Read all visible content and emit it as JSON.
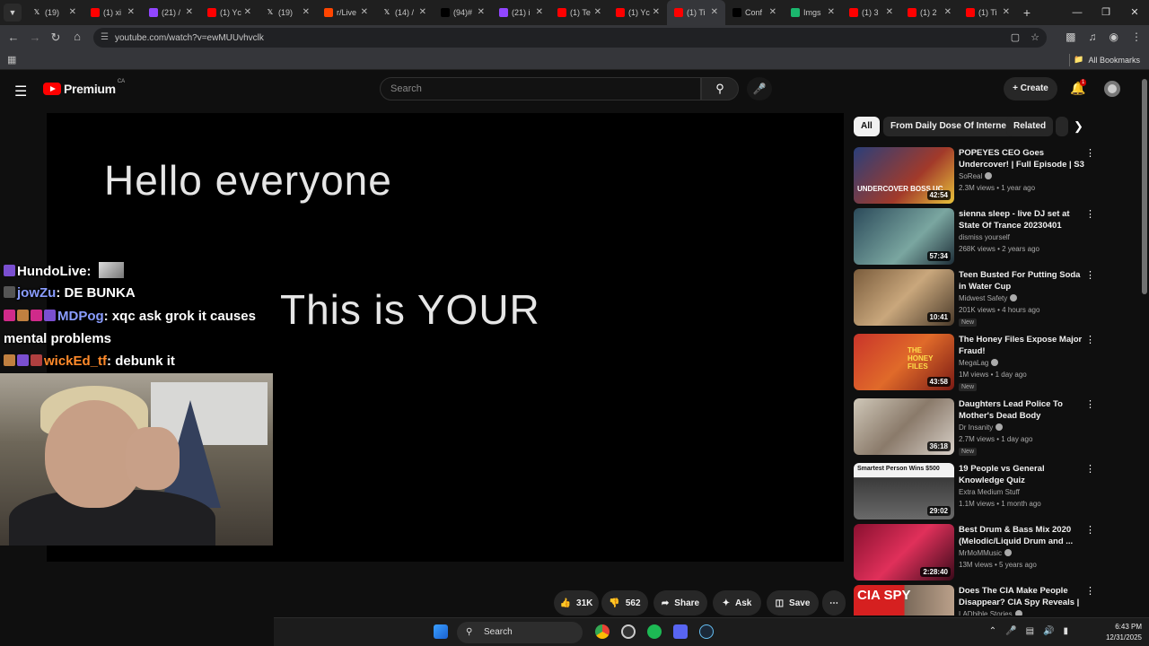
{
  "browser": {
    "tabs": [
      {
        "label": "(19)",
        "fav": "x",
        "color": "#000000"
      },
      {
        "label": "(1) xi",
        "fav": "yt",
        "color": "#ff0000"
      },
      {
        "label": "(21) /",
        "fav": "tw",
        "color": "#9146ff"
      },
      {
        "label": "(1) Yc",
        "fav": "yt",
        "color": "#ff0000"
      },
      {
        "label": "(19)",
        "fav": "x",
        "color": "#000000"
      },
      {
        "label": "r/Live",
        "fav": "rd",
        "color": "#ff4500"
      },
      {
        "label": "(14) /",
        "fav": "x",
        "color": "#000000"
      },
      {
        "label": "(94)#",
        "fav": "tt",
        "color": "#000000"
      },
      {
        "label": "(21) i",
        "fav": "tw",
        "color": "#9146ff"
      },
      {
        "label": "(1) Te",
        "fav": "yt",
        "color": "#ff0000"
      },
      {
        "label": "(1) Yc",
        "fav": "yt",
        "color": "#ff0000"
      },
      {
        "label": "(1) Ti",
        "fav": "yt",
        "color": "#ff0000",
        "active": true
      },
      {
        "label": "Conf",
        "fav": "tt",
        "color": "#000000"
      },
      {
        "label": "Imgs",
        "fav": "im",
        "color": "#1bb76e"
      },
      {
        "label": "(1) 3",
        "fav": "yt",
        "color": "#ff0000"
      },
      {
        "label": "(1) 2",
        "fav": "yt",
        "color": "#ff0000"
      },
      {
        "label": "(1) Ti",
        "fav": "yt",
        "color": "#ff0000"
      }
    ],
    "url": "youtube.com/watch?v=ewMUUvhvclk",
    "bookmarks_label": "All Bookmarks"
  },
  "youtube": {
    "logo_text": "Premium",
    "country": "CA",
    "search_placeholder": "Search",
    "create_label": "Create",
    "notif_count": "1",
    "video": {
      "line1": "Hello everyone",
      "line2": "This is YOUR"
    },
    "actions": {
      "likes": "31K",
      "dislikes": "562",
      "share": "Share",
      "ask": "Ask",
      "save": "Save"
    },
    "chips": [
      "All",
      "From Daily Dose Of Internet",
      "Related"
    ],
    "suggestions": [
      {
        "title": "POPEYES CEO Goes Undercover! | Full Episode | S3 ...",
        "channel": "SoReal",
        "verified": true,
        "meta": "2.3M views • 1 year ago",
        "duration": "42:54",
        "new": false,
        "thumb": "linear-gradient(135deg,#2a3f7a,#a23a2a 60%,#e8c23a)"
      },
      {
        "title": "sienna sleep - live DJ set at State Of Trance 20230401",
        "channel": "dismiss yourself",
        "verified": false,
        "meta": "268K views • 2 years ago",
        "duration": "57:34",
        "new": false,
        "thumb": "linear-gradient(135deg,#2b4a5a,#7aa6a0 60%,#1e2e38)"
      },
      {
        "title": "Teen Busted For Putting Soda in Water Cup",
        "channel": "Midwest Safety",
        "verified": true,
        "meta": "201K views • 4 hours ago",
        "duration": "10:41",
        "new": true,
        "thumb": "linear-gradient(135deg,#7a5c3c,#c9a77c 50%,#4a3a2a)"
      },
      {
        "title": "The Honey Files Expose Major Fraud!",
        "channel": "MegaLag",
        "verified": true,
        "meta": "1M views • 1 day ago",
        "duration": "43:58",
        "new": true,
        "thumb": "linear-gradient(135deg,#c9342a,#e06a2a 50%,#7a1a14)"
      },
      {
        "title": "Daughters Lead Police To Mother's Dead Body",
        "channel": "Dr Insanity",
        "verified": true,
        "meta": "2.7M views • 1 day ago",
        "duration": "36:18",
        "new": true,
        "thumb": "linear-gradient(135deg,#cfc7b8,#8a7a6a 50%,#d8d0c8)"
      },
      {
        "title": "19 People vs General Knowledge Quiz",
        "channel": "Extra Medium Stuff",
        "verified": false,
        "meta": "1.1M views • 1 month ago",
        "duration": "29:02",
        "new": false,
        "thumb": "linear-gradient(180deg,#f2f2f2 0%,#f2f2f2 25%,#3a3a3a 26%,#6a6a6a 100%)"
      },
      {
        "title": "Best Drum & Bass Mix 2020 (Melodic/Liquid Drum and ...",
        "channel": "MrMoMMusic",
        "verified": true,
        "meta": "13M views • 5 years ago",
        "duration": "2:28:40",
        "new": false,
        "thumb": "linear-gradient(135deg,#8a1030,#e0305a 50%,#3a0a1a)"
      },
      {
        "title": "Does The CIA Make People Disappear? CIA Spy Reveals | ...",
        "channel": "LADbible Stories",
        "verified": true,
        "meta": "",
        "duration": "",
        "new": false,
        "thumb": "linear-gradient(90deg,#d62020 0%,#d62020 50%,#7a6a5a 51%,#bba08a 100%)"
      }
    ],
    "cia_thumb_text": "CIA SPY",
    "quiz_thumb_text": "Smartest Person Wins $500",
    "popeyes_thumb_text": "UNDERCOVER BOSS UC",
    "honey_thumb_text": "THE HONEY FILES"
  },
  "stream_chat": [
    {
      "user": "HundoLive",
      "user_color": "#ffffff",
      "msg": "",
      "badges": [
        "#7a4fd0"
      ],
      "image": true
    },
    {
      "user": "jowZu",
      "user_color": "#8a9dff",
      "msg": "DE BUNKA",
      "badges": [
        "#555555"
      ]
    },
    {
      "user": "MDPog",
      "user_color": "#8a9dff",
      "msg": "xqc ask grok it causes",
      "msg2": "mental problems",
      "badges": [
        "#d02a8a",
        "#c08040",
        "#d02a8a",
        "#7a4fd0"
      ]
    },
    {
      "user": "wickEd_tf",
      "user_color": "#ff8a2a",
      "msg": "debunk it",
      "badges": [
        "#c08040",
        "#7a4fd0",
        "#b04040"
      ]
    }
  ],
  "taskbar": {
    "search_label": "Search",
    "time": "6:43 PM",
    "date": "12/31/2025"
  }
}
